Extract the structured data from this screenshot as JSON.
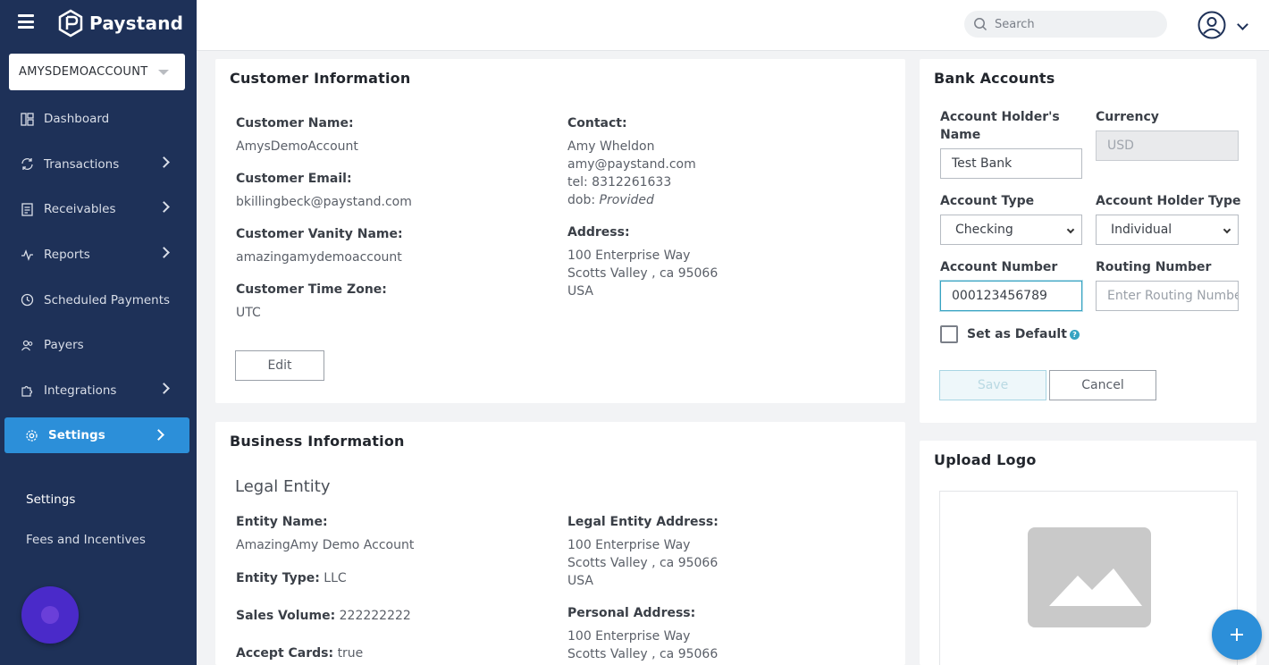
{
  "app": {
    "brand": "Paystand",
    "account": "AMYSDEMOACCOUNT",
    "search_placeholder": "Search"
  },
  "sidebar": {
    "items": [
      {
        "label": "Dashboard",
        "icon": "dashboard-icon"
      },
      {
        "label": "Transactions",
        "icon": "transactions-icon"
      },
      {
        "label": "Receivables",
        "icon": "receivables-icon"
      },
      {
        "label": "Reports",
        "icon": "reports-icon"
      },
      {
        "label": "Scheduled Payments",
        "icon": "clock-icon"
      },
      {
        "label": "Payers",
        "icon": "payers-icon"
      },
      {
        "label": "Integrations",
        "icon": "puzzle-icon"
      },
      {
        "label": "Settings",
        "icon": "gear-icon"
      }
    ],
    "subitems": [
      "Settings",
      "Fees and Incentives"
    ]
  },
  "customer": {
    "title": "Customer Information",
    "name_label": "Customer Name:",
    "name": "AmysDemoAccount",
    "email_label": "Customer Email:",
    "email": "bkillingbeck@paystand.com",
    "vanity_label": "Customer Vanity Name:",
    "vanity": "amazingamydemoaccount",
    "tz_label": "Customer Time Zone:",
    "tz": "UTC",
    "contact_label": "Contact:",
    "contact_name": "Amy Wheldon",
    "contact_email": "amy@paystand.com",
    "contact_tel": "tel: 8312261633",
    "contact_dob_prefix": "dob: ",
    "contact_dob": "Provided",
    "address_label": "Address:",
    "address_line1": "100 Enterprise Way",
    "address_line2": "Scotts Valley , ca 95066",
    "address_line3": "USA",
    "edit_label": "Edit"
  },
  "business": {
    "title": "Business Information",
    "subtitle": "Legal Entity",
    "entity_name_label": "Entity Name:",
    "entity_name": "AmazingAmy Demo Account",
    "entity_type_label": "Entity Type:",
    "entity_type": "LLC",
    "sales_volume_label": "Sales Volume:",
    "sales_volume": "222222222",
    "accept_cards_label": "Accept Cards:",
    "accept_cards": "true",
    "legal_address_label": "Legal Entity Address:",
    "legal_address_line1": "100 Enterprise Way",
    "legal_address_line2": "Scotts Valley , ca 95066",
    "legal_address_line3": "USA",
    "personal_address_label": "Personal Address:",
    "personal_address_line1": "100 Enterprise Way",
    "personal_address_line2": "Scotts Valley , ca 95066"
  },
  "bank": {
    "title": "Bank Accounts",
    "holder_name_label_1": "Account Holder's",
    "holder_name_label_2": "Name",
    "holder_name": "Test Bank",
    "currency_label": "Currency",
    "currency": "USD",
    "account_type_label": "Account Type",
    "account_type": "Checking",
    "holder_type_label": "Account Holder Type",
    "holder_type": "Individual",
    "account_number_label": "Account Number",
    "account_number": "000123456789",
    "routing_label": "Routing Number",
    "routing_placeholder": "Enter Routing Number",
    "default_label": "Set as Default",
    "save_label": "Save",
    "cancel_label": "Cancel"
  },
  "logo": {
    "title": "Upload Logo"
  },
  "colors": {
    "sidebar": "#1e3158",
    "accent": "#2c8fd9",
    "focus": "#36a3c2"
  }
}
